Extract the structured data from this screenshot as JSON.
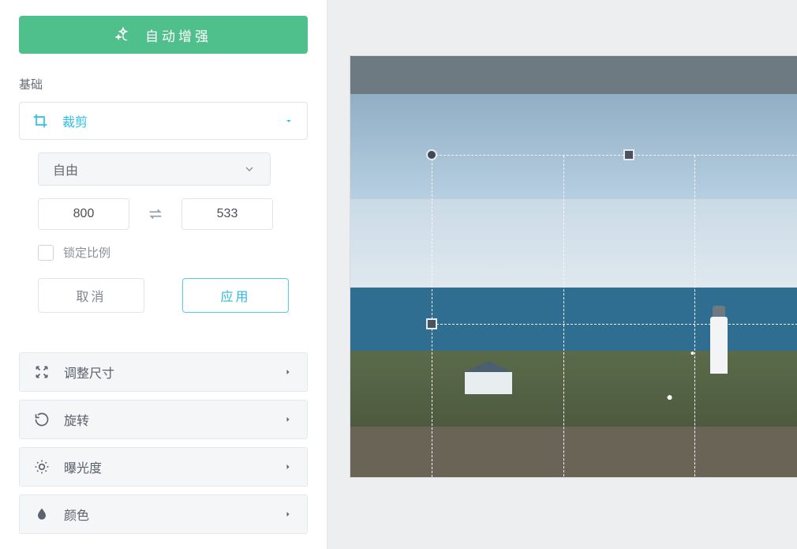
{
  "auto_enhance": {
    "label": "自动增强"
  },
  "section_basic": "基础",
  "crop_tool": {
    "label": "裁剪"
  },
  "crop_panel": {
    "mode_label": "自由",
    "width": "800",
    "height": "533",
    "lock_label": "锁定比例",
    "cancel_label": "取消",
    "apply_label": "应用"
  },
  "tools": {
    "resize": "调整尺寸",
    "rotate": "旋转",
    "exposure": "曝光度",
    "color": "颜色"
  }
}
